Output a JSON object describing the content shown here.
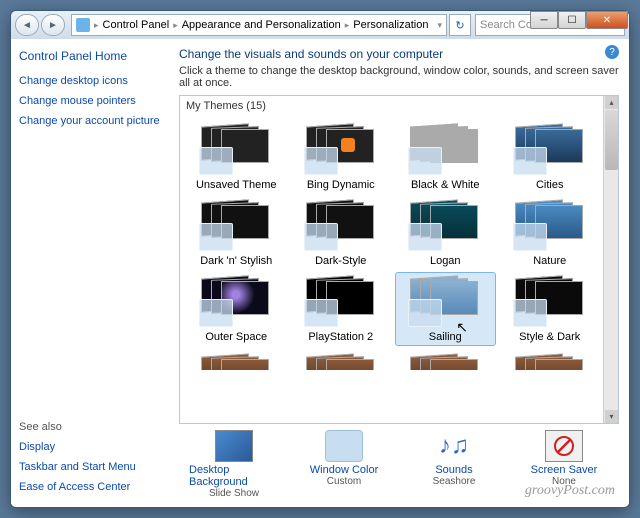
{
  "titlebar": {
    "breadcrumb": [
      "Control Panel",
      "Appearance and Personalization",
      "Personalization"
    ],
    "search_placeholder": "Search Control Panel"
  },
  "sidebar": {
    "home": "Control Panel Home",
    "links": [
      "Change desktop icons",
      "Change mouse pointers",
      "Change your account picture"
    ],
    "see_also_heading": "See also",
    "see_also": [
      "Display",
      "Taskbar and Start Menu",
      "Ease of Access Center"
    ]
  },
  "main": {
    "heading": "Change the visuals and sounds on your computer",
    "subtitle": "Click a theme to change the desktop background, window color, sounds, and screen saver all at once.",
    "group_label": "My Themes (15)",
    "themes": [
      {
        "name": "Unsaved Theme",
        "cls": ""
      },
      {
        "name": "Bing Dynamic",
        "cls": "bing"
      },
      {
        "name": "Black & White",
        "cls": "bw"
      },
      {
        "name": "Cities",
        "cls": "cities"
      },
      {
        "name": "Dark 'n' Stylish",
        "cls": "dark"
      },
      {
        "name": "Dark-Style",
        "cls": "dark"
      },
      {
        "name": "Logan",
        "cls": "logan"
      },
      {
        "name": "Nature",
        "cls": "nature"
      },
      {
        "name": "Outer Space",
        "cls": "space"
      },
      {
        "name": "PlayStation 2",
        "cls": "ps2"
      },
      {
        "name": "Sailing",
        "cls": "sailing",
        "selected": true,
        "cursor": true
      },
      {
        "name": "Style & Dark",
        "cls": "sd"
      }
    ],
    "partial_row": [
      {
        "name": "",
        "cls": "part"
      },
      {
        "name": "",
        "cls": "part"
      },
      {
        "name": "",
        "cls": "part"
      },
      {
        "name": "",
        "cls": "part"
      }
    ],
    "bottom": [
      {
        "label": "Desktop Background",
        "sub": "Slide Show",
        "icon": "oi-bg"
      },
      {
        "label": "Window Color",
        "sub": "Custom",
        "icon": "oi-color"
      },
      {
        "label": "Sounds",
        "sub": "Seashore",
        "icon": "oi-sound"
      },
      {
        "label": "Screen Saver",
        "sub": "None",
        "icon": "oi-ss"
      }
    ]
  },
  "watermark": "groovyPost.com"
}
